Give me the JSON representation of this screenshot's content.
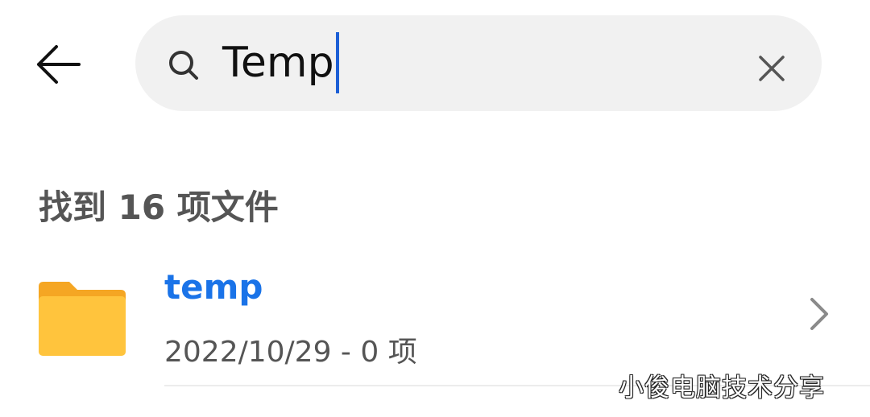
{
  "search": {
    "value": "Temp"
  },
  "results": {
    "count_text": "找到 16 项文件",
    "items": [
      {
        "name": "temp",
        "meta": "2022/10/29 - 0 项",
        "icon": "folder-icon"
      }
    ]
  },
  "watermark": "小俊电脑技术分享",
  "colors": {
    "accent": "#1a73e8",
    "caret": "#1c5fd6",
    "search_bg": "#f1f1f1",
    "folder": "#ffc43d",
    "folder_tab": "#f5a623"
  }
}
